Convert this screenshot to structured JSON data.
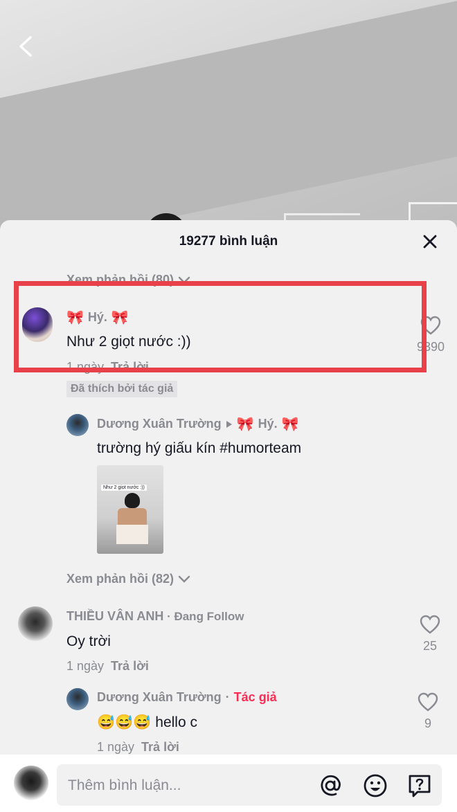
{
  "header": {
    "comment_count_title": "19277 bình luận"
  },
  "top_view_replies": {
    "label": "Xem phản hồi (80)"
  },
  "comments": [
    {
      "username": "Hý.",
      "text": "Như 2 giọt nước :))",
      "time": "1 ngày",
      "reply_label": "Trả lời",
      "likes": "9390",
      "liked_by_author": "Đã thích bởi tác giả"
    },
    {
      "username": "THIỀU VÂN ANH",
      "suffix": " · Đang Follow",
      "text": "Oy trời",
      "time": "1 ngày",
      "reply_label": "Trả lời",
      "likes": "25"
    }
  ],
  "replies": [
    {
      "username": "Dương Xuân Trường",
      "reply_to": "Hý.",
      "text": "trường hý giấu kín #humorteam",
      "thumb_caption": "Như 2 giọt nước :))"
    },
    {
      "username": "Dương Xuân Trường",
      "author_tag": "Tác giả",
      "emoji": "😅😅😅",
      "text": " hello c",
      "time": "1 ngày",
      "reply_label": "Trả lời",
      "likes": "9"
    }
  ],
  "middle_view_replies": {
    "label": "Xem phản hồi (82)"
  },
  "input": {
    "placeholder": "Thêm bình luận..."
  },
  "icons": {
    "back": "chevron-left-icon",
    "close": "close-icon",
    "mention": "at-sign-icon",
    "emoji": "smiley-icon",
    "question": "question-box-icon",
    "heart": "heart-outline-icon",
    "bow": "pink-bow-icon"
  },
  "colors": {
    "highlight": "#e8414a",
    "author_tag": "#fe2c55",
    "bow": "#e58aa8"
  }
}
